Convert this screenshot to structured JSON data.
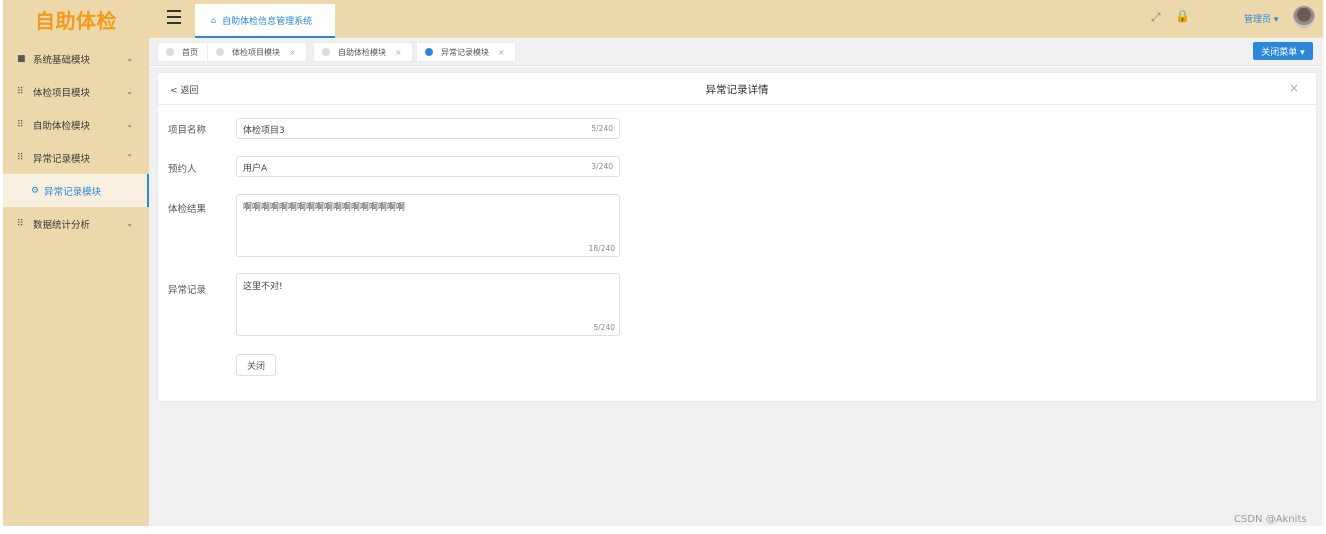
{
  "app": {
    "logo": "自助体检"
  },
  "sidebar": {
    "items": [
      {
        "icon": "■",
        "icon_name": "dashboard-icon",
        "label": "系统基础模块",
        "arrow": "⌄"
      },
      {
        "icon": "⠿",
        "icon_name": "grid-icon",
        "label": "体检项目模块",
        "arrow": "⌄"
      },
      {
        "icon": "⠿",
        "icon_name": "grid-icon",
        "label": "自助体检模块",
        "arrow": "⌄"
      },
      {
        "icon": "⠿",
        "icon_name": "grid-icon",
        "label": "异常记录模块",
        "arrow": "⌃"
      },
      {
        "icon": "⠿",
        "icon_name": "grid-icon",
        "label": "数据统计分析",
        "arrow": "⌄"
      }
    ],
    "subitem": {
      "icon": "⚙",
      "label": "异常记录模块"
    }
  },
  "header": {
    "home_tab": "自助体检信息管理系统",
    "home_icon": "⌂",
    "fullscreen_icon": "⤢",
    "lock_icon": "🔒",
    "user": "管理员 ▾"
  },
  "tabs": [
    {
      "label": "首页",
      "closable": false,
      "active": false
    },
    {
      "label": "体检项目模块",
      "closable": true,
      "active": false
    },
    {
      "label": "自助体检模块",
      "closable": true,
      "active": false
    },
    {
      "label": "异常记录模块",
      "closable": true,
      "active": true
    }
  ],
  "tab_close_glyph": "×",
  "close_menu_button": "关闭菜单 ▾",
  "panel": {
    "back": "< 返回",
    "title": "异常记录详情",
    "close_glyph": "×",
    "fields": {
      "project_name": {
        "label": "项目名称",
        "value": "体检项目3",
        "count": "5/240"
      },
      "reserver": {
        "label": "预约人",
        "value": "用户A",
        "count": "3/240"
      },
      "result": {
        "label": "体检结果",
        "value": "啊啊啊啊啊啊啊啊啊啊啊啊啊啊啊啊啊啊",
        "count": "18/240"
      },
      "abnormal": {
        "label": "异常记录",
        "value": "这里不对!",
        "count": "5/240"
      }
    },
    "close_button": "关闭"
  },
  "watermark": "CSDN @Aknits",
  "colors": {
    "accent": "#2b88d8",
    "sidebar_bg": "#edd8ac",
    "logo": "#f39a1a"
  }
}
